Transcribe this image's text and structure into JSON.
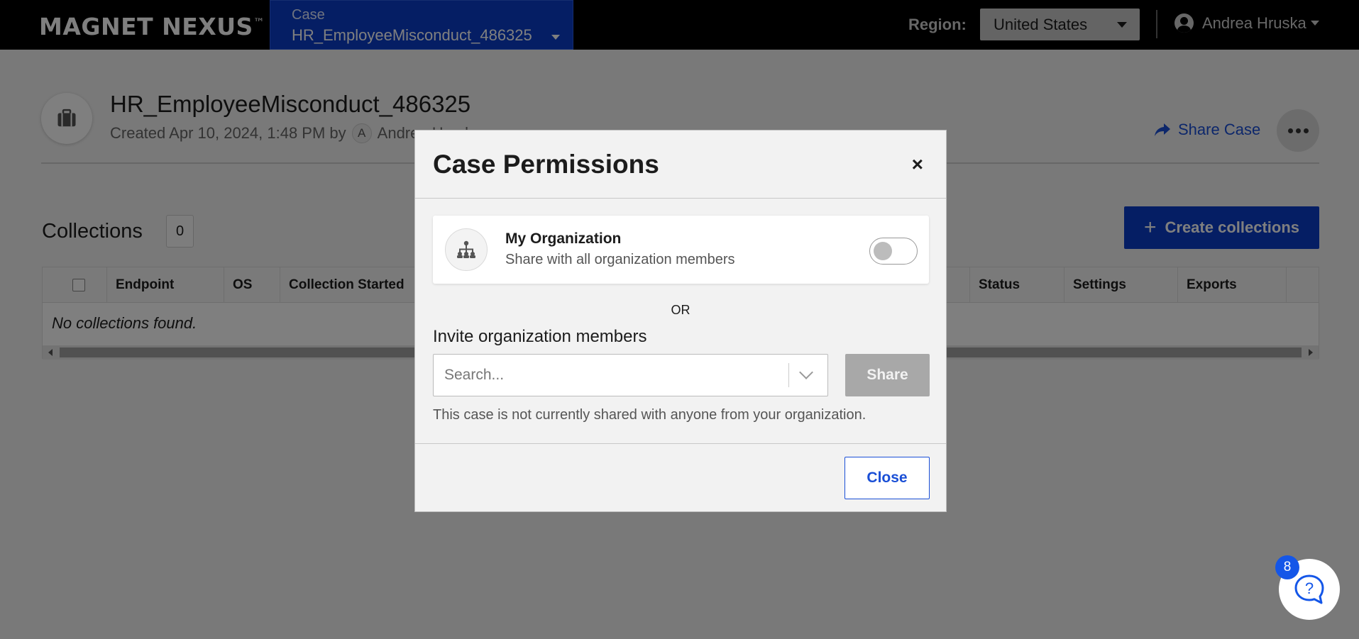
{
  "app": {
    "brand": "MAGNET NEXUS",
    "brand_tm": "™"
  },
  "case_selector": {
    "caption": "Case",
    "value": "HR_EmployeeMisconduct_486325"
  },
  "region": {
    "label": "Region:",
    "value": "United States"
  },
  "user": {
    "name": "Andrea Hruska"
  },
  "case": {
    "title": "HR_EmployeeMisconduct_486325",
    "created_prefix": "Created Apr 10, 2024, 1:48 PM by",
    "creator_initial": "A",
    "creator_name": "Andrea Hruska",
    "share_label": "Share Case"
  },
  "collections": {
    "title": "Collections",
    "count": "0",
    "create_label": "Create collections",
    "columns": [
      "Endpoint",
      "OS",
      "Collection Started",
      "Status",
      "Settings",
      "Exports"
    ],
    "empty_message": "No collections found."
  },
  "help": {
    "badge_count": "8"
  },
  "modal": {
    "title": "Case Permissions",
    "close_symbol": "×",
    "org": {
      "name": "My Organization",
      "description": "Share with all organization members",
      "toggle_on": false
    },
    "or_text": "OR",
    "invite_label": "Invite organization members",
    "search_placeholder": "Search...",
    "share_label": "Share",
    "not_shared_text": "This case is not currently shared with anyone from your organization.",
    "close_label": "Close"
  },
  "colors": {
    "primary": "#0a3cc9",
    "link": "#1a4fd6",
    "topbar": "#000000",
    "badge": "#1456e8"
  }
}
